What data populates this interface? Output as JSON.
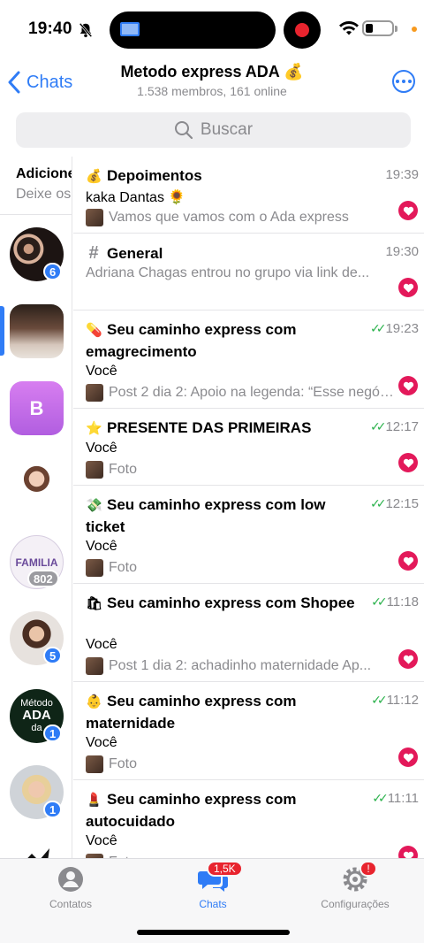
{
  "status": {
    "time": "19:40",
    "battery_level": 0.3
  },
  "nav": {
    "back_label": "Chats",
    "title": "Metodo express ADA 💰",
    "subtitle": "1.538 membros, 161 online"
  },
  "search": {
    "placeholder": "Buscar"
  },
  "sidebar": {
    "header_title": "Adicione",
    "header_sub": "Deixe os",
    "items": [
      {
        "badge": "6"
      },
      {
        "badge": ""
      },
      {
        "letter": "B"
      },
      {
        "badge": ""
      },
      {
        "label": "FAMILIA",
        "badge": "802"
      },
      {
        "badge": "5"
      },
      {
        "label_line1": "Método",
        "label_line2": "ADA",
        "label_line3": "da",
        "badge": "1"
      },
      {
        "badge": "1"
      }
    ]
  },
  "topics": [
    {
      "emoji": "💰",
      "name": "Depoimentos",
      "time": "19:39",
      "sender": "kaka Dantas 🌻",
      "preview": "Vamos que vamos com o Ada express",
      "read": false
    },
    {
      "emoji": "#",
      "name": "General",
      "time": "19:30",
      "sender": "",
      "preview": "Adriana Chagas entrou no grupo via link de...",
      "read": false
    },
    {
      "emoji": "💊",
      "name": "Seu caminho express com emagrecimento",
      "time": "19:23",
      "sender": "Você",
      "preview": "Post 2 dia 2: Apoio na legenda: “Esse negóc...",
      "read": true
    },
    {
      "emoji": "⭐",
      "name": "PRESENTE DAS PRIMEIRAS",
      "time": "12:17",
      "sender": "Você",
      "preview": "Foto",
      "read": true
    },
    {
      "emoji": "💸",
      "name": "Seu caminho express com low ticket",
      "time": "12:15",
      "sender": "Você",
      "preview": "Foto",
      "read": true
    },
    {
      "emoji": "🛍",
      "name": "Seu caminho express com Shopee",
      "time": "11:18",
      "sender": "Você",
      "preview": "Post 1 dia 2: achadinho maternidade  Ap...",
      "read": true
    },
    {
      "emoji": "👶",
      "name": "Seu caminho express com maternidade",
      "time": "11:12",
      "sender": "Você",
      "preview": "Foto",
      "read": true
    },
    {
      "emoji": "💄",
      "name": "Seu caminho express com autocuidado",
      "time": "11:11",
      "sender": "Você",
      "preview": "Foto",
      "read": true
    }
  ],
  "tabbar": {
    "contacts": "Contatos",
    "chats": "Chats",
    "chats_badge": "1,5K",
    "settings": "Configurações",
    "settings_badge": "!"
  }
}
